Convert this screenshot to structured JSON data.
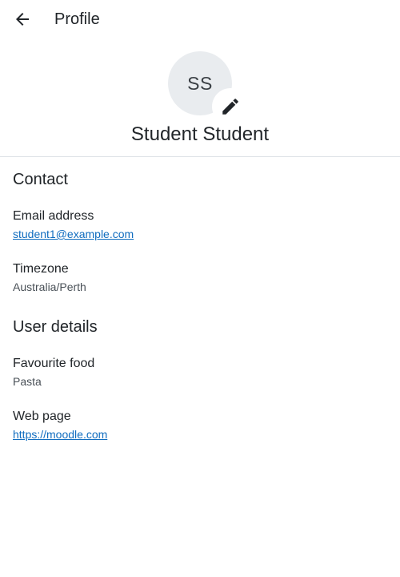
{
  "header": {
    "title": "Profile",
    "back_icon": "arrow-left-icon"
  },
  "profile": {
    "initials": "SS",
    "full_name": "Student Student",
    "edit_icon": "pencil-icon",
    "avatar_bg": "#e9ecef"
  },
  "sections": {
    "contact": {
      "title": "Contact",
      "email_label": "Email address",
      "email_value": "student1@example.com",
      "timezone_label": "Timezone",
      "timezone_value": "Australia/Perth"
    },
    "user_details": {
      "title": "User details",
      "food_label": "Favourite food",
      "food_value": "Pasta",
      "webpage_label": "Web page",
      "webpage_value": "https://moodle.com"
    }
  },
  "colors": {
    "link": "#0f6cbf",
    "text": "#212529",
    "muted": "#495057",
    "divider": "#dee2e6"
  }
}
